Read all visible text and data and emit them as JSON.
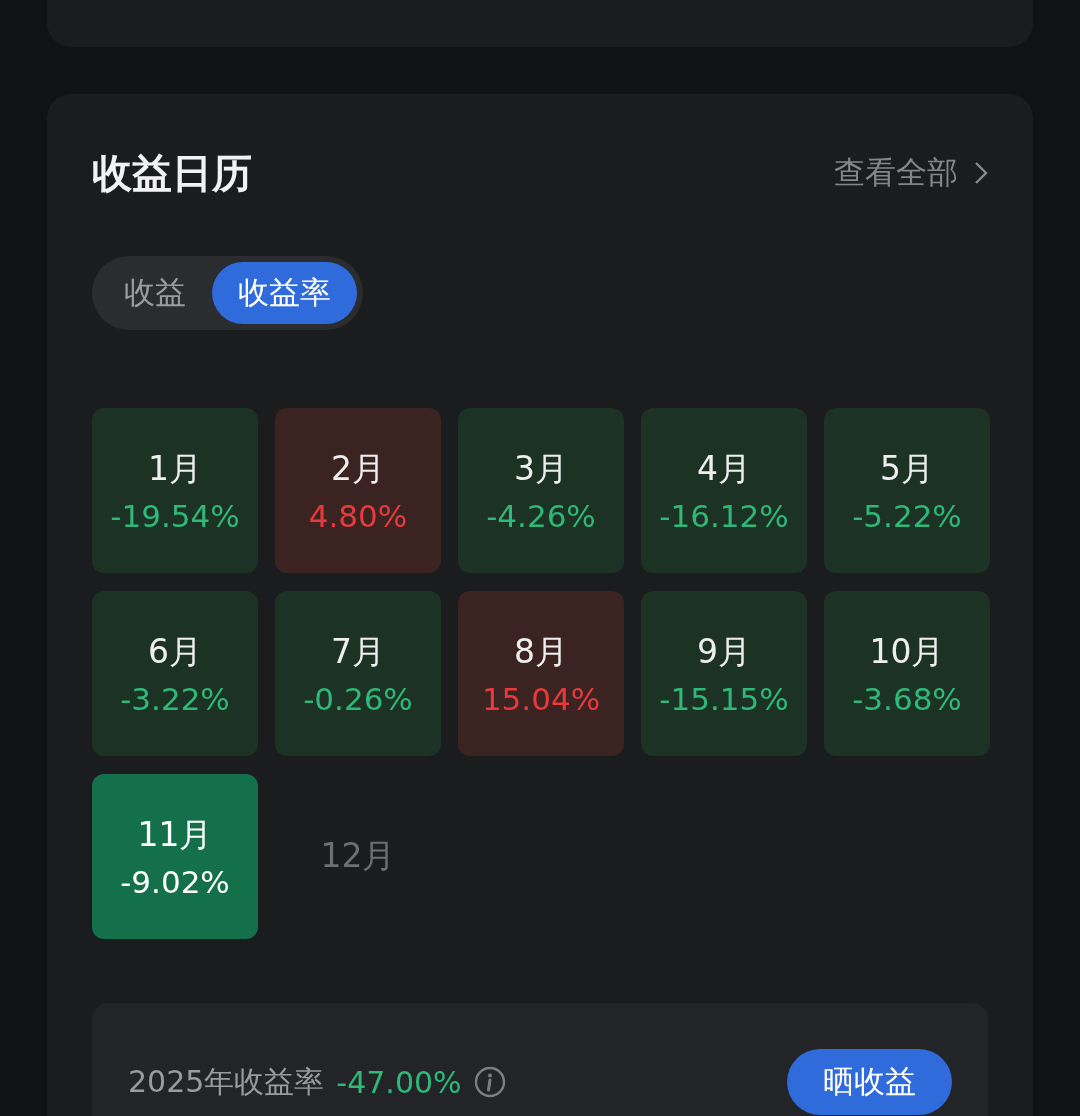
{
  "card": {
    "title": "收益日历",
    "view_all": "查看全部",
    "toggle": [
      {
        "label": "收益",
        "selected": false
      },
      {
        "label": "收益率",
        "selected": true
      }
    ],
    "months": [
      {
        "label": "1月",
        "value": "-19.54%",
        "kind": "down",
        "selected": false
      },
      {
        "label": "2月",
        "value": "4.80%",
        "kind": "up",
        "selected": false
      },
      {
        "label": "3月",
        "value": "-4.26%",
        "kind": "down",
        "selected": false
      },
      {
        "label": "4月",
        "value": "-16.12%",
        "kind": "down",
        "selected": false
      },
      {
        "label": "5月",
        "value": "-5.22%",
        "kind": "down",
        "selected": false
      },
      {
        "label": "6月",
        "value": "-3.22%",
        "kind": "down",
        "selected": false
      },
      {
        "label": "7月",
        "value": "-0.26%",
        "kind": "down",
        "selected": false
      },
      {
        "label": "8月",
        "value": "15.04%",
        "kind": "up",
        "selected": false
      },
      {
        "label": "9月",
        "value": "-15.15%",
        "kind": "down",
        "selected": false
      },
      {
        "label": "10月",
        "value": "-3.68%",
        "kind": "down",
        "selected": false
      },
      {
        "label": "11月",
        "value": "-9.02%",
        "kind": "down",
        "selected": true
      },
      {
        "label": "12月",
        "kind": "empty",
        "selected": false
      }
    ],
    "summary": {
      "label": "2025年收益率",
      "value": "-47.00%",
      "kind": "down",
      "share_button": "晒收益"
    }
  }
}
